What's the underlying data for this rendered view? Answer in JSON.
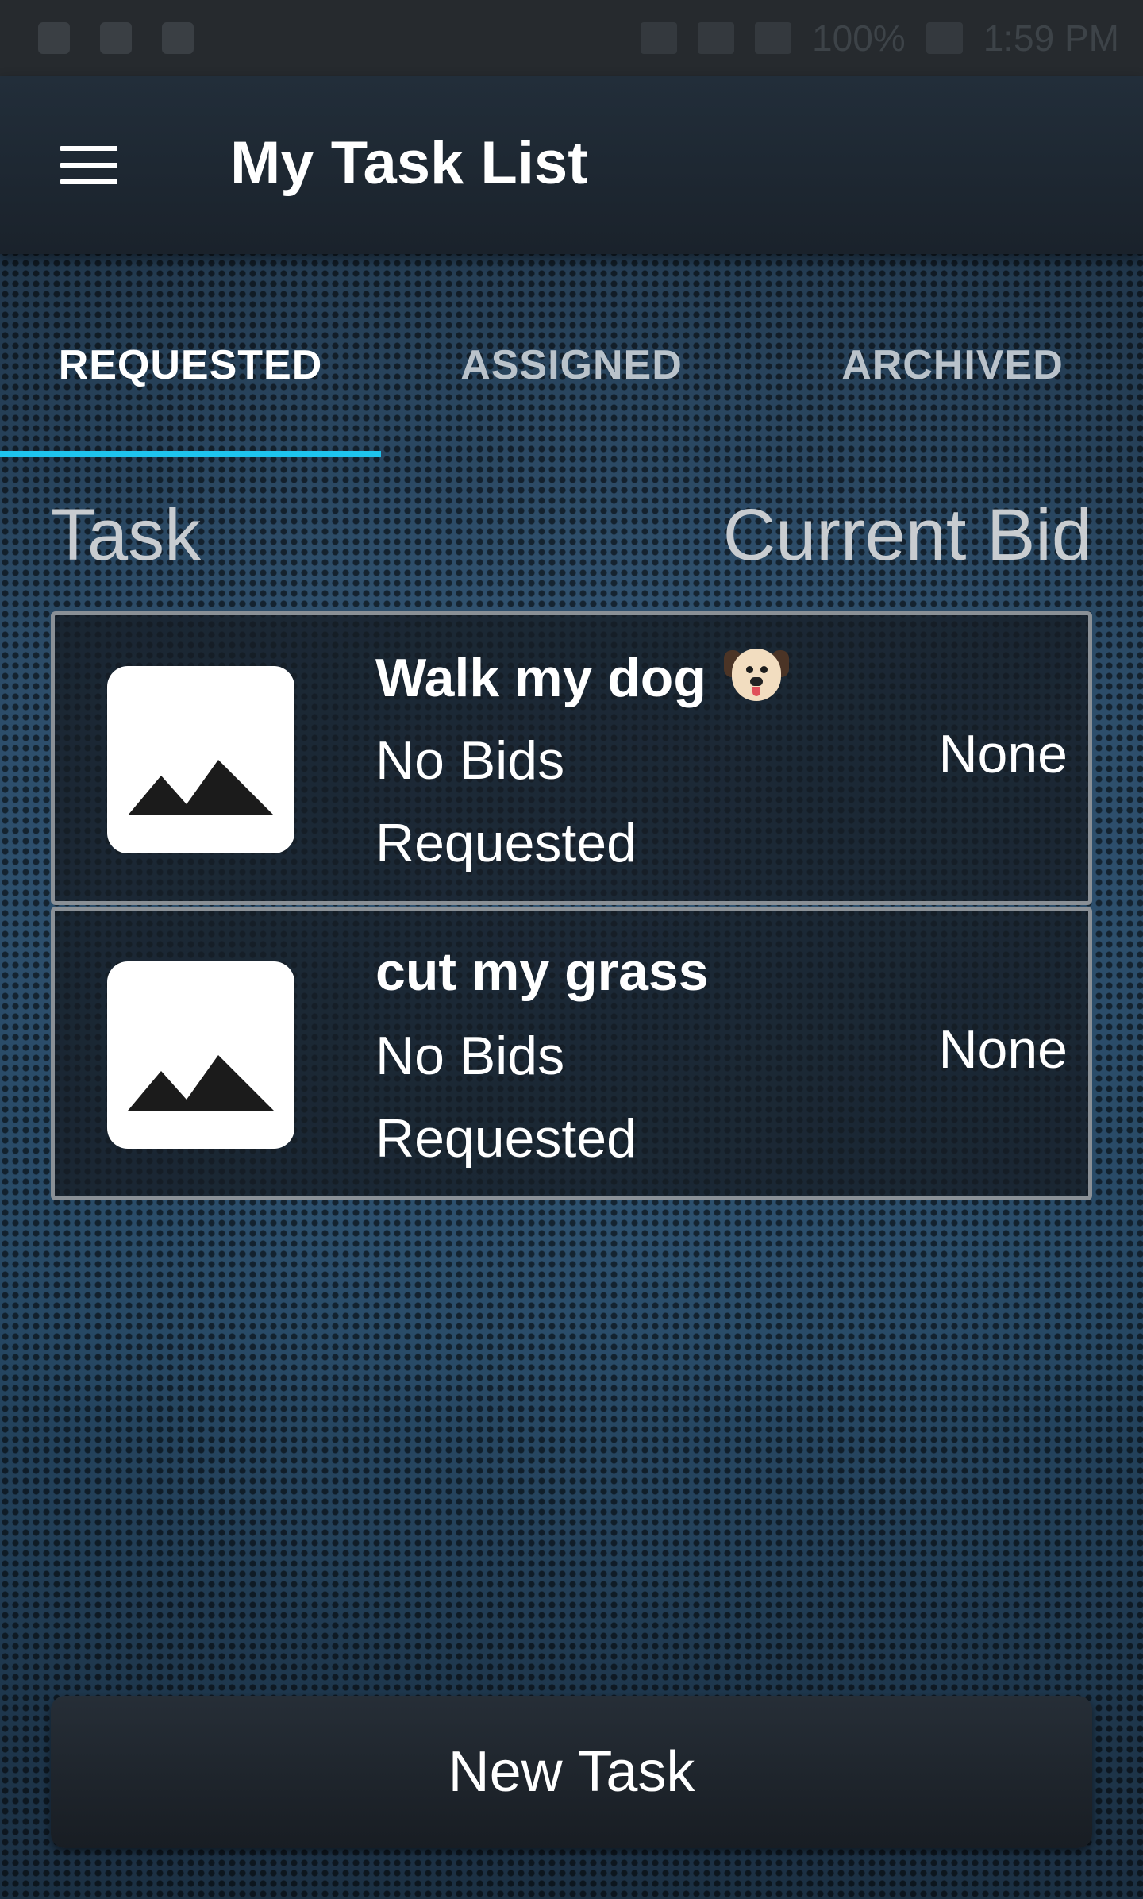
{
  "status_bar": {
    "battery": "100%",
    "time": "1:59 PM"
  },
  "app_bar": {
    "title": "My Task List"
  },
  "tabs": [
    {
      "label": "REQUESTED",
      "selected": true
    },
    {
      "label": "ASSIGNED",
      "selected": false
    },
    {
      "label": "ARCHIVED",
      "selected": false
    }
  ],
  "columns": {
    "task": "Task",
    "bid": "Current Bid"
  },
  "tasks": [
    {
      "title": "Walk my dog",
      "title_icon": "dog-face-emoji",
      "bids": "No Bids",
      "status": "Requested",
      "current_bid": "None",
      "thumbnail_icon": "image-placeholder-icon"
    },
    {
      "title": "cut my grass",
      "bids": "No Bids",
      "status": "Requested",
      "current_bid": "None",
      "thumbnail_icon": "image-placeholder-icon"
    }
  ],
  "actions": {
    "new_task": "New Task"
  },
  "colors": {
    "accent": "#1ec4ee",
    "app_bar": "#1f2933",
    "text": "#ffffff"
  }
}
